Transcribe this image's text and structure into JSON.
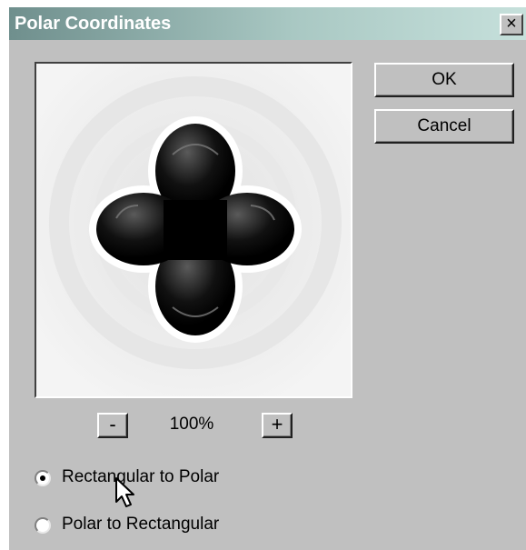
{
  "dialog": {
    "title": "Polar Coordinates",
    "close_label": "×"
  },
  "buttons": {
    "ok_label": "OK",
    "cancel_label": "Cancel"
  },
  "zoom": {
    "minus_label": "-",
    "level": "100%",
    "plus_label": "+"
  },
  "options": [
    {
      "label": "Rectangular to Polar",
      "selected": true
    },
    {
      "label": "Polar to Rectangular",
      "selected": false
    }
  ],
  "icons": {
    "preview": "four-lobed-black-flower-shape",
    "pointer": "mouse-pointer-icon"
  }
}
